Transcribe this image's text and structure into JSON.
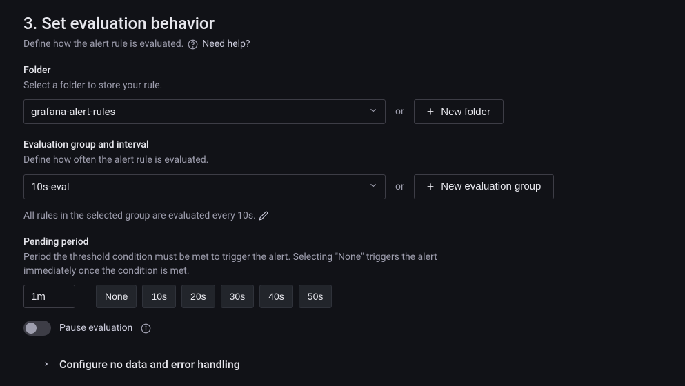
{
  "heading": "3. Set evaluation behavior",
  "subheading": "Define how the alert rule is evaluated.",
  "need_help": "Need help?",
  "folder": {
    "label": "Folder",
    "help": "Select a folder to store your rule.",
    "value": "grafana-alert-rules",
    "or": "or",
    "new_button": "New folder"
  },
  "group": {
    "label": "Evaluation group and interval",
    "help": "Define how often the alert rule is evaluated.",
    "value": "10s-eval",
    "or": "or",
    "new_button": "New evaluation group",
    "hint": "All rules in the selected group are evaluated every 10s."
  },
  "pending": {
    "label": "Pending period",
    "help": "Period the threshold condition must be met to trigger the alert. Selecting \"None\" triggers the alert immediately once the condition is met.",
    "value": "1m",
    "options": [
      "None",
      "10s",
      "20s",
      "30s",
      "40s",
      "50s"
    ]
  },
  "pause": {
    "label": "Pause evaluation",
    "enabled": false
  },
  "collapsible": {
    "label": "Configure no data and error handling"
  }
}
